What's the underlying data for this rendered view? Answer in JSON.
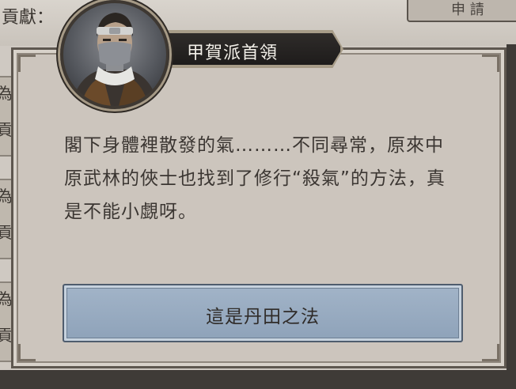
{
  "background": {
    "contribution_label": "貢獻：",
    "top_button_label": "申 請",
    "row_labels": [
      "為",
      "貢",
      "為",
      "貢",
      "為",
      "貢"
    ]
  },
  "dialog": {
    "speaker_name": "甲賀派首領",
    "portrait_icon": "masked-ninja-portrait",
    "message": "閣下身體裡散發的氣………不同尋常，原來中原武林的俠士也找到了修行“殺氣”的方法，真是不能小覷呀。",
    "choice_label": "這是丹田之法"
  },
  "colors": {
    "dialog_bg": "#ccc5bd",
    "button_bg": "#99acc1",
    "nameplate_bg": "#262321"
  }
}
